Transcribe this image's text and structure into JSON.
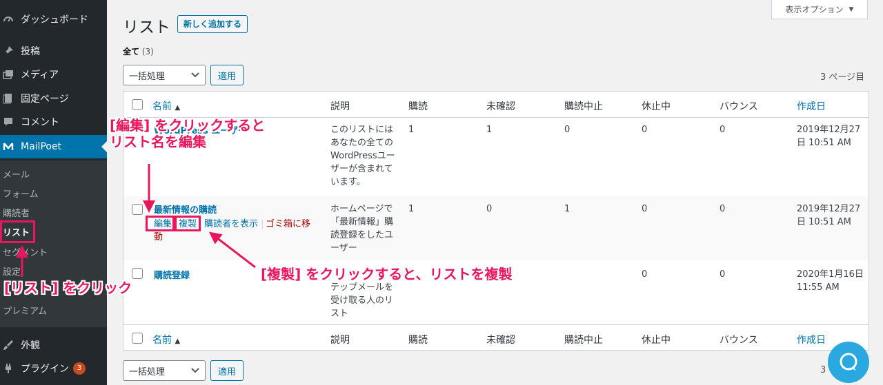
{
  "sidebar": {
    "items": [
      {
        "label": "ダッシュボード",
        "icon": "dashboard-icon"
      },
      {
        "label": "投稿",
        "icon": "pin-icon"
      },
      {
        "label": "メディア",
        "icon": "media-icon"
      },
      {
        "label": "固定ページ",
        "icon": "pages-icon"
      },
      {
        "label": "コメント",
        "icon": "comment-icon"
      },
      {
        "label": "MailPoet",
        "icon": "mailpoet-icon"
      },
      {
        "label": "外観",
        "icon": "appearance-icon"
      },
      {
        "label": "プラグイン",
        "icon": "plugins-icon",
        "badge": "3"
      }
    ],
    "submenu": [
      "メール",
      "フォーム",
      "購読者",
      "リスト",
      "セグメント",
      "設定",
      "",
      "プレミアム"
    ]
  },
  "header": {
    "title": "リスト",
    "add_new": "新しく追加する",
    "screen_options": "表示オプション"
  },
  "filters": {
    "all_label": "全て",
    "all_count": "(3)"
  },
  "bulk": {
    "select_label": "一括処理",
    "apply_label": "適用"
  },
  "pagination": {
    "text": "3 ページ目",
    "text_bottom": "3"
  },
  "table": {
    "columns": [
      "名前",
      "説明",
      "購読",
      "未確認",
      "購読中止",
      "休止中",
      "バウンス",
      "作成日"
    ],
    "rows": [
      {
        "name": "WordPress ユーザー",
        "desc": [
          "このリストには",
          "あなたの全ての",
          "WordPressユー",
          "ザーが含まれて",
          "います。"
        ],
        "subscribed": "1",
        "unconfirmed": "1",
        "unsubscribed": "0",
        "inactive": "0",
        "bounced": "0",
        "date": [
          "2019年12月27",
          "日 10:51 AM"
        ]
      },
      {
        "name": "最新情報の購読",
        "desc": [
          "ホームページで",
          "「最新情報」購",
          "読登録をしたユ",
          "ーザー"
        ],
        "subscribed": "1",
        "unconfirmed": "0",
        "unsubscribed": "1",
        "inactive": "0",
        "bounced": "0",
        "date": [
          "2019年12月27",
          "日 10:51 AM"
        ],
        "actions": {
          "edit": "編集",
          "duplicate": "複製",
          "view": "購読者を表示",
          "trash_1": "ゴミ箱に移",
          "trash_2": "動"
        }
      },
      {
        "name": "購読登録",
        "desc": [
          "",
          "テップメールを",
          "受け取る人のリ",
          "スト"
        ],
        "subscribed": "",
        "unconfirmed": "",
        "unsubscribed": "",
        "inactive": "0",
        "bounced": "0",
        "date": [
          "2020年1月16日",
          "11:55 AM"
        ]
      }
    ]
  },
  "annotations": {
    "edit_1": "[編集] をクリックすると",
    "edit_2": "リスト名を編集",
    "duplicate": "[複製] をクリックすると、リストを複製",
    "list_click": "[リスト] をクリック"
  },
  "colors": {
    "accent": "#0073aa",
    "annotation": "#e8175d",
    "sidebar": "#23282d",
    "help": "#2aa8e0"
  }
}
